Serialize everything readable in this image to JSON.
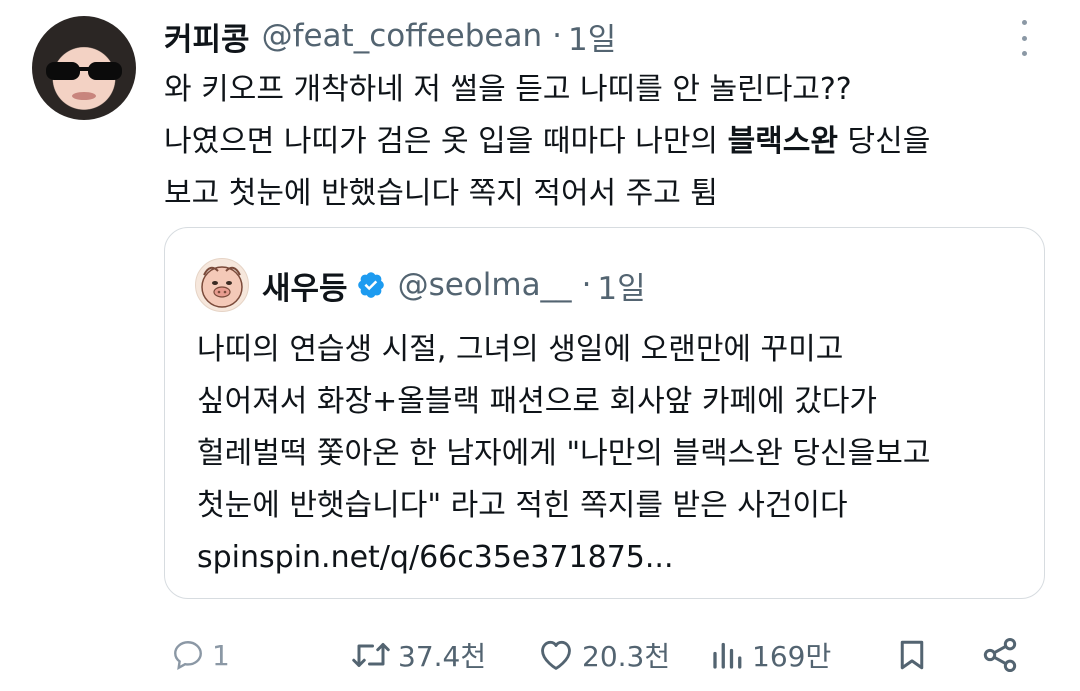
{
  "tweet": {
    "display_name": "커피콩",
    "handle": "@feat_coffeebean",
    "separator": "·",
    "time": "1일",
    "lines": [
      "와 키오프 개착하네 저 썰을 듣고 나띠를 안 놀린다고??",
      "나였으면 나띠가 검은 옷 입을 때마다 나만의 ",
      "블랙스완",
      " 당신을",
      "보고 첫눈에 반했습니다 쪽지 적어서 주고 튐"
    ]
  },
  "quote": {
    "display_name": "새우등",
    "verified_icon": "verified-badge-icon",
    "handle": "@seolma__",
    "separator": "·",
    "time": "1일",
    "lines": [
      "나띠의 연습생 시절, 그녀의 생일에 오랜만에 꾸미고",
      "싶어져서 화장+올블랙 패션으로 회사앞 카페에 갔다가",
      "헐레벌떡 쫓아온 한 남자에게 \"나만의 블랙스완 당신을보고",
      "첫눈에 반햇습니다\" 라고 적힌 쪽지를 받은 사건이다",
      "spinspin.net/q/66c35e371875..."
    ]
  },
  "actions": {
    "reply_count": "1",
    "retweet_count": "37.4천",
    "like_count": "20.3천",
    "view_count": "169만"
  },
  "colors": {
    "primary_text": "#0f1419",
    "secondary_text": "#536471",
    "verified_blue": "#1d9bf0",
    "border": "#d7dce0"
  }
}
